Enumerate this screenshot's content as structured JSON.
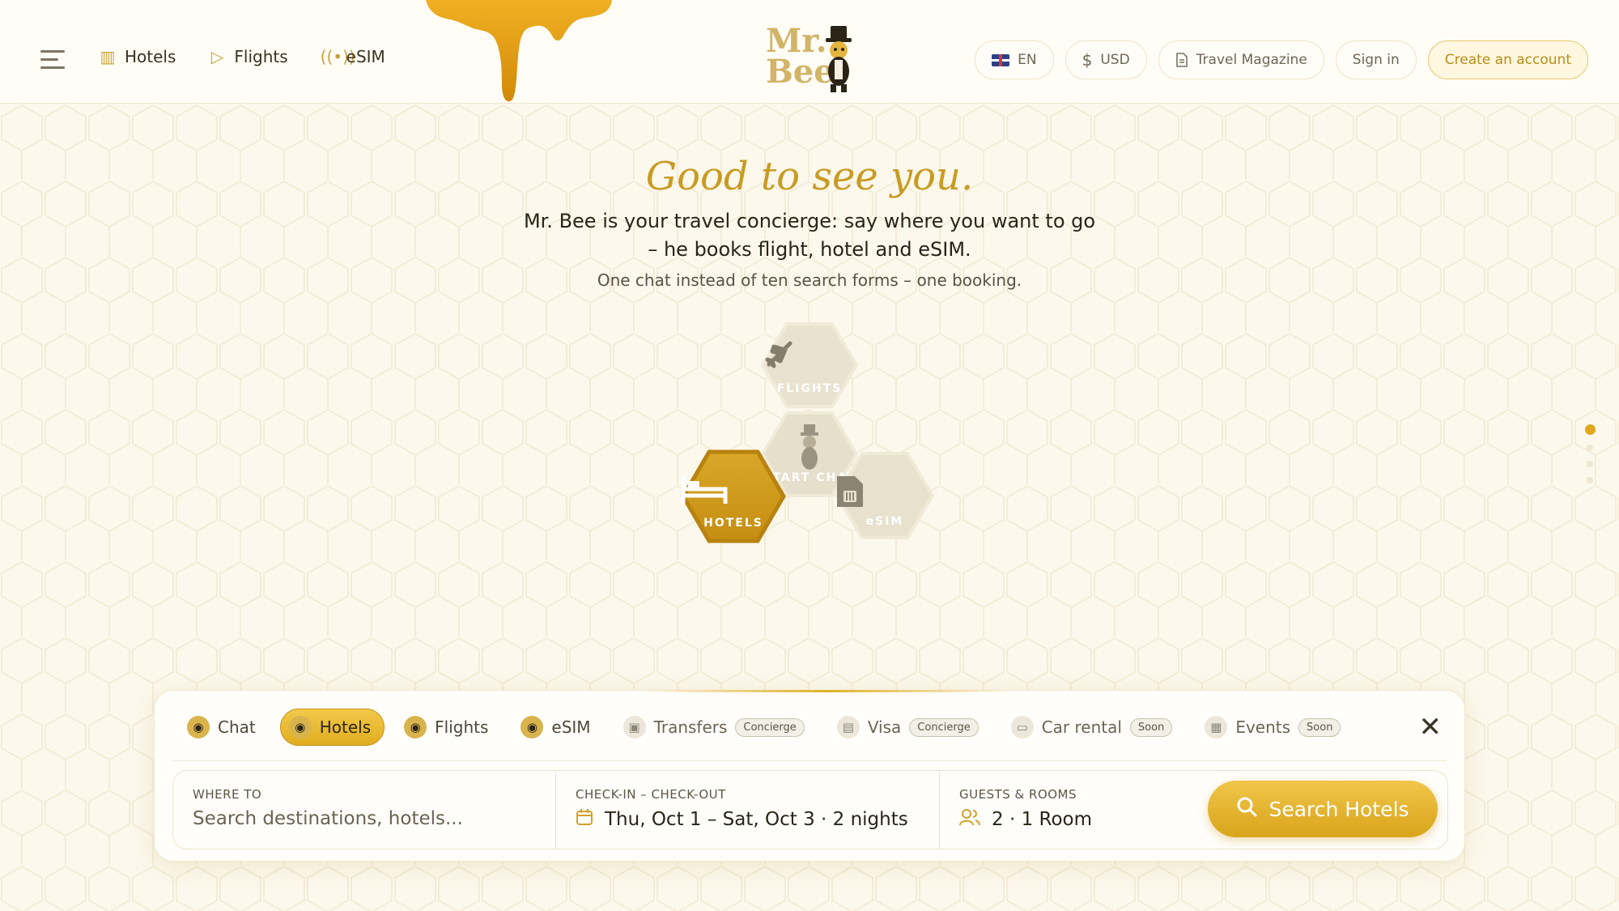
{
  "header": {
    "nav": [
      {
        "label": "Hotels",
        "icon": "hotel-building-icon"
      },
      {
        "label": "Flights",
        "icon": "paper-plane-icon"
      },
      {
        "label": "eSIM",
        "icon": "signal-waves-icon"
      }
    ],
    "logo_text_line1": "Mr.",
    "logo_text_line2": "Bee",
    "language": "EN",
    "currency": "USD",
    "magazine": "Travel Magazine",
    "sign_in": "Sign in",
    "create_account": "Create an account"
  },
  "hero": {
    "greeting": "Good to see you.",
    "lead": "Mr. Bee is your travel concierge: say where you want to go – he books flight, hotel and eSIM.",
    "sub": "One chat instead of ten search forms – one booking."
  },
  "hexes": {
    "flights": "FLIGHTS",
    "start_chat": "START CHAT",
    "hotels": "HOTELS",
    "esim": "eSIM"
  },
  "pager": {
    "active_index": 0,
    "count": 4
  },
  "panel": {
    "tabs": [
      {
        "label": "Chat",
        "badge": ""
      },
      {
        "label": "Hotels",
        "badge": ""
      },
      {
        "label": "Flights",
        "badge": ""
      },
      {
        "label": "eSIM",
        "badge": ""
      },
      {
        "label": "Transfers",
        "badge": "Concierge"
      },
      {
        "label": "Visa",
        "badge": "Concierge"
      },
      {
        "label": "Car rental",
        "badge": "Soon"
      },
      {
        "label": "Events",
        "badge": "Soon"
      }
    ],
    "active_tab": "Hotels",
    "where_label": "WHERE TO",
    "where_placeholder": "Search destinations, hotels...",
    "dates_label": "CHECK-IN – CHECK-OUT",
    "dates_value": "Thu, Oct 1 – Sat, Oct 3 · 2 nights",
    "guests_label": "GUESTS & ROOMS",
    "guests_value": "2 · 1 Room",
    "search_button": "Search Hotels"
  },
  "colors": {
    "accent": "#e0ad1f",
    "greeting": "#c99b23",
    "background": "#fdfaf0"
  }
}
